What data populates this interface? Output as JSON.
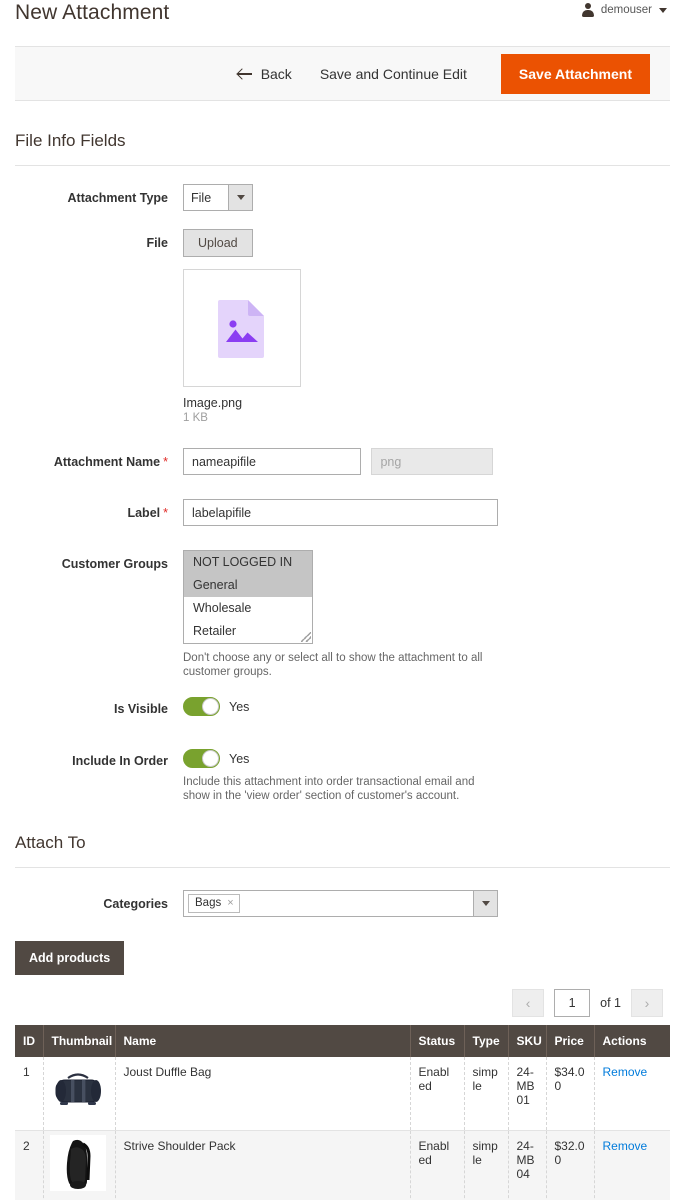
{
  "header": {
    "title": "New Attachment",
    "user": {
      "name": "demouser",
      "icon": "user-icon",
      "caret": "chevron-down-icon"
    }
  },
  "toolbar": {
    "back_label": "Back",
    "save_continue_label": "Save and Continue Edit",
    "save_label": "Save Attachment",
    "primary_color": "#eb5202"
  },
  "file_info": {
    "section_title": "File Info Fields",
    "attachment_type": {
      "label": "Attachment Type",
      "value": "File"
    },
    "file": {
      "label": "File",
      "upload_label": "Upload",
      "preview_icon": "image-file-icon",
      "file_name": "Image.png",
      "file_size": "1 KB"
    },
    "attachment_name": {
      "label": "Attachment Name",
      "required": "*",
      "value": "nameapifile",
      "extension_placeholder": "png",
      "extension_value": ""
    },
    "label_field": {
      "label": "Label",
      "required": "*",
      "value": "labelapifile"
    },
    "customer_groups": {
      "label": "Customer Groups",
      "options": [
        {
          "text": "NOT LOGGED IN",
          "selected": true
        },
        {
          "text": "General",
          "selected": true
        },
        {
          "text": "Wholesale",
          "selected": false
        },
        {
          "text": "Retailer",
          "selected": false
        }
      ],
      "note": "Don't choose any or select all to show the attachment to all customer groups."
    },
    "is_visible": {
      "label": "Is Visible",
      "state": "Yes",
      "on": true
    },
    "include_in_order": {
      "label": "Include In Order",
      "state": "Yes",
      "on": true,
      "note": "Include this attachment into order transactional email and show in the 'view order' section of customer's account."
    }
  },
  "attach_to": {
    "section_title": "Attach To",
    "categories": {
      "label": "Categories",
      "tokens": [
        {
          "text": "Bags",
          "remove": "×"
        }
      ]
    },
    "add_products_label": "Add products",
    "pager": {
      "prev_icon": "chevron-left-icon",
      "next_icon": "chevron-right-icon",
      "current_page": "1",
      "of_text": "of 1"
    },
    "grid": {
      "columns": [
        "ID",
        "Thumbnail",
        "Name",
        "Status",
        "Type",
        "SKU",
        "Price",
        "Actions"
      ],
      "rows": [
        {
          "id": "1",
          "thumbnail": "duffle-bag-thumbnail",
          "name": "Joust Duffle Bag",
          "status": "Enabled",
          "type": "simple",
          "sku": "24-MB01",
          "price": "$34.00",
          "action": "Remove"
        },
        {
          "id": "2",
          "thumbnail": "shoulder-pack-thumbnail",
          "name": "Strive Shoulder Pack",
          "status": "Enabled",
          "type": "simple",
          "sku": "24-MB04",
          "price": "$32.00",
          "action": "Remove"
        }
      ]
    }
  }
}
